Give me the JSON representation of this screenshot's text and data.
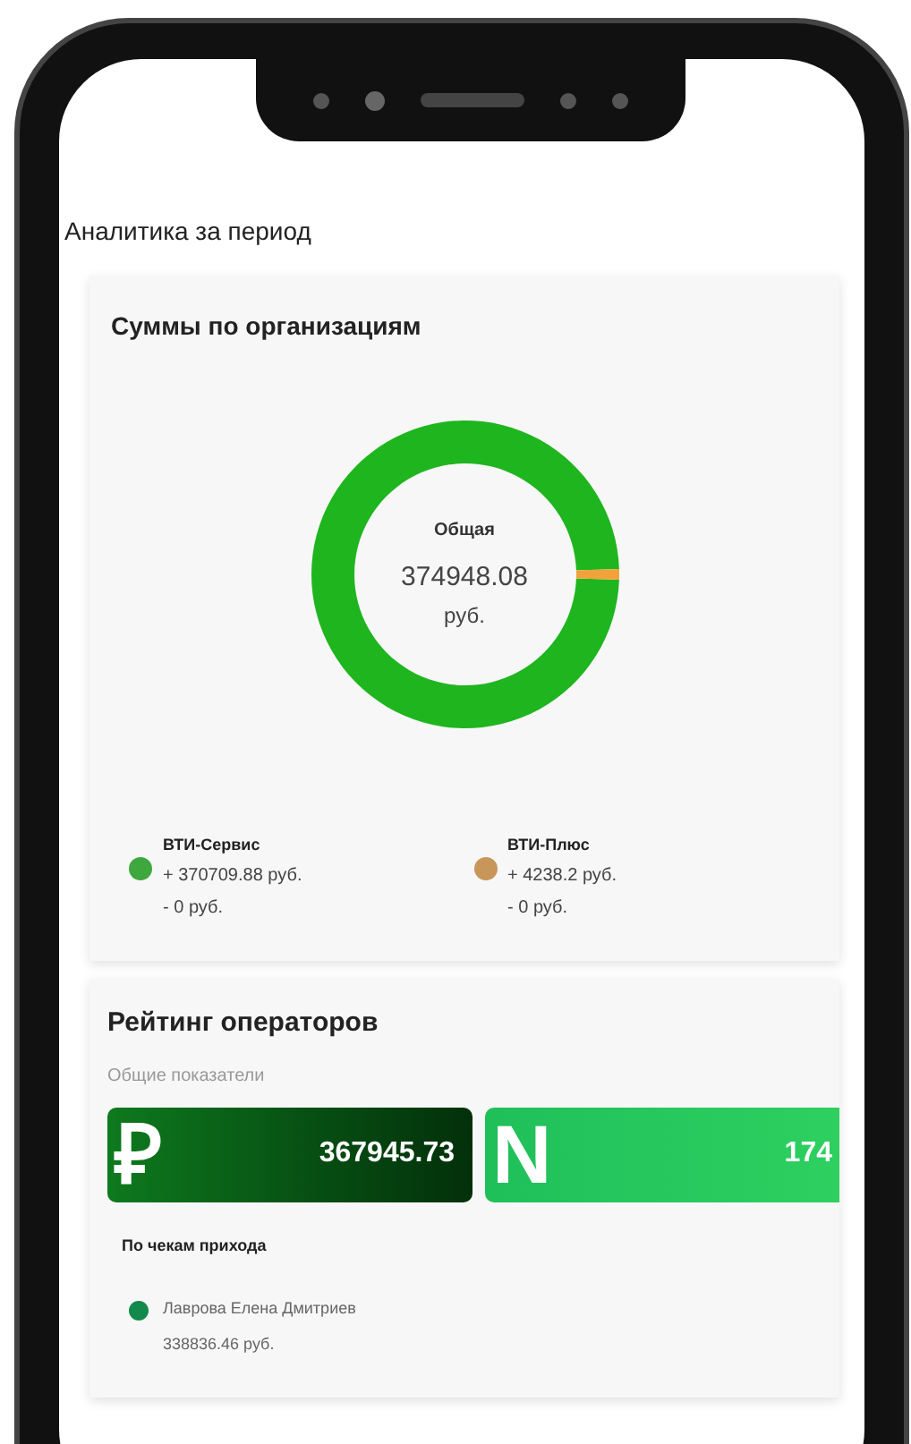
{
  "page_title": "Аналитика за период",
  "org_sums": {
    "title": "Суммы по организациям",
    "center_label": "Общая",
    "center_value": "374948.08",
    "center_unit": "руб.",
    "chart_data": {
      "type": "donut",
      "categories": [
        "ВТИ-Сервис",
        "ВТИ-Плюс"
      ],
      "values": [
        98.87,
        1.13
      ],
      "colors": [
        "#1fb51f",
        "#f2a23a"
      ]
    },
    "legend": [
      {
        "color": "#3ea83e",
        "plus": "+ 370709.88 руб.",
        "minus": "- 0 руб."
      },
      {
        "color": "#c8965a",
        "plus": "+ 4238.2 руб.",
        "minus": "- 0 руб."
      }
    ]
  },
  "operators": {
    "title": "Рейтинг операторов",
    "subtitle": "Общие показатели",
    "tiles": [
      {
        "kind": "dark",
        "glyph": "₽",
        "value": "367945.73"
      },
      {
        "kind": "bright",
        "glyph": "N",
        "value": "174"
      }
    ],
    "section_label": "По чекам прихода",
    "rows": [
      {
        "name": "Лаврова Елена Дмитриев",
        "amount": "338836.46 руб.",
        "color": "#138a4c"
      }
    ]
  }
}
